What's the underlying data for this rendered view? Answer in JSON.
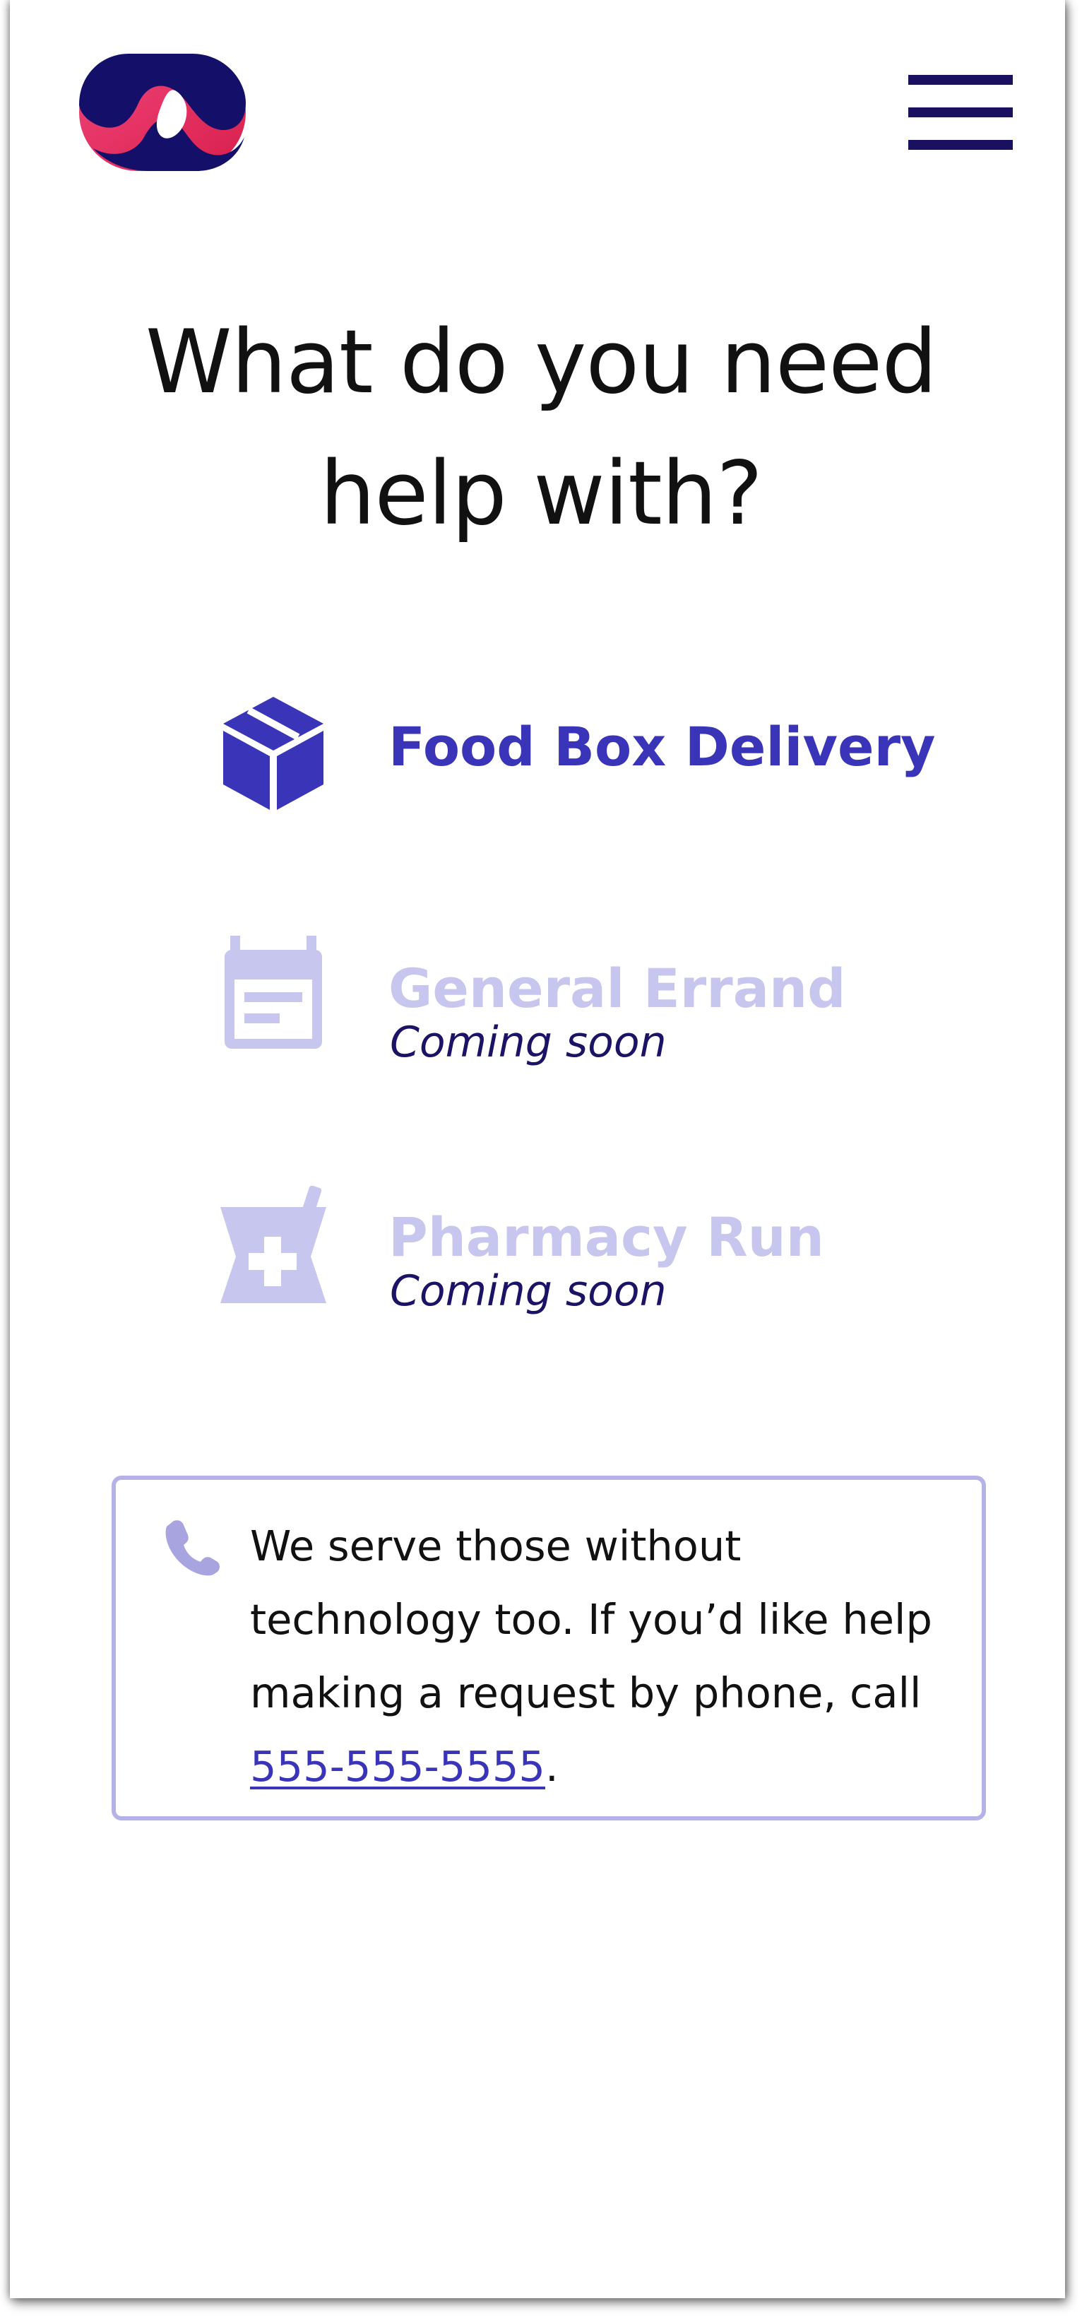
{
  "header": {
    "logo_icon": "brand-logo",
    "menu_icon": "hamburger-menu-icon"
  },
  "page_title": {
    "line1": "What do you need",
    "line2": "help with?"
  },
  "options": [
    {
      "label": "Food Box Delivery",
      "subtitle": "",
      "icon": "box-icon",
      "color": "#3a35b8",
      "enabled": true
    },
    {
      "label": "General Errand",
      "subtitle": "Coming soon",
      "icon": "calendar-icon",
      "color": "#c7c6ee",
      "enabled": false
    },
    {
      "label": "Pharmacy Run",
      "subtitle": "Coming soon",
      "icon": "mortar-pestle-icon",
      "color": "#c7c6ee",
      "enabled": false
    }
  ],
  "notice": {
    "icon": "phone-icon",
    "text_before": "We serve those without technology too. If you’d like help making a request by phone, call ",
    "phone_number": "555-555-5555",
    "text_after": "."
  },
  "colors": {
    "accent": "#3a35b8",
    "disabled": "#c7c6ee",
    "navy": "#1a1060",
    "border": "#b4b2e6",
    "logo_pink": "#e8356e",
    "logo_navy": "#14106a"
  }
}
